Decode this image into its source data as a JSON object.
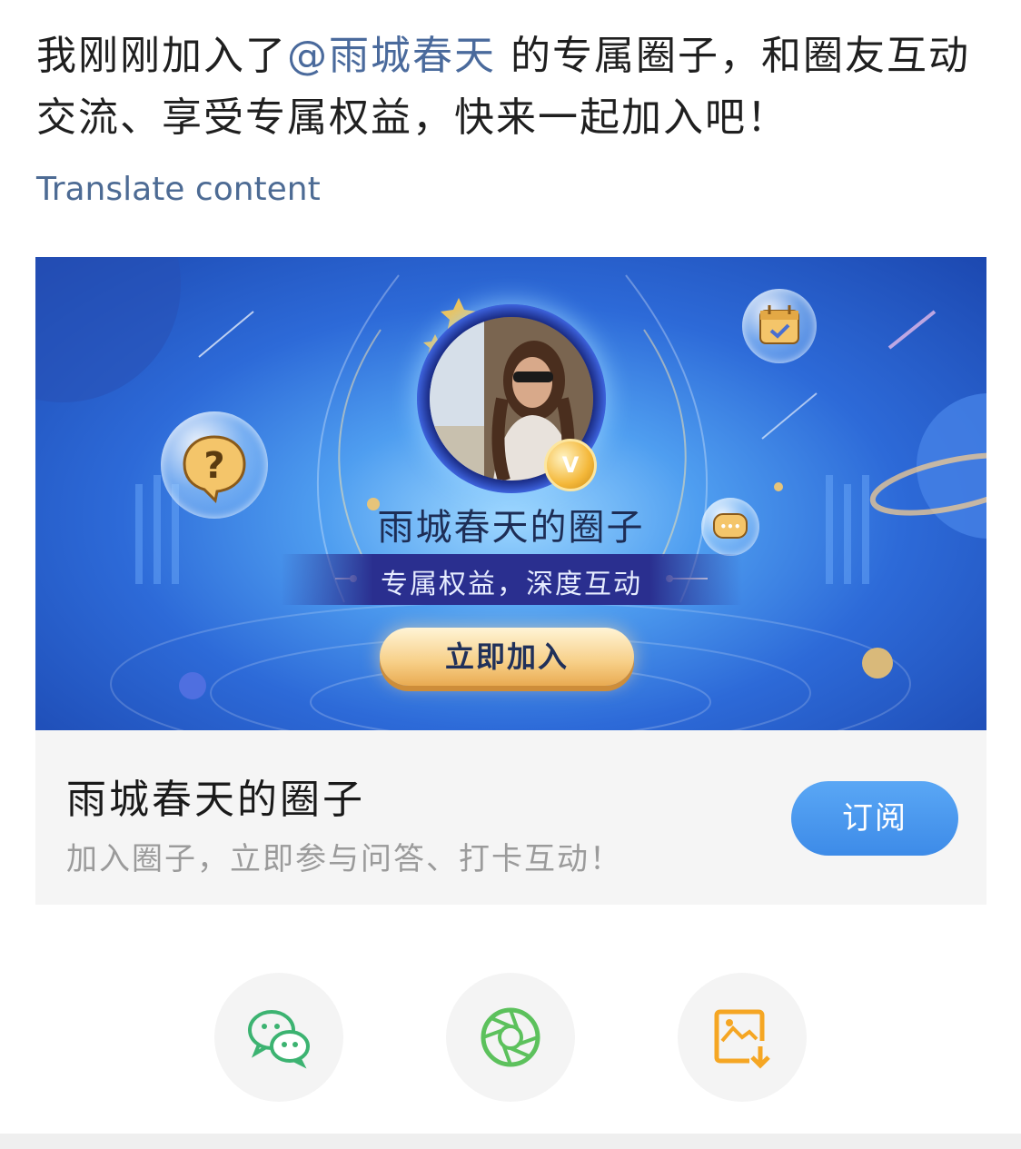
{
  "post": {
    "prefix": "我刚刚加入了",
    "mention": "@雨城春天",
    "suffix": " 的专属圈子，和圈友互动交流、享受专属权益，快来一起加入吧！",
    "translate_label": "Translate content"
  },
  "banner": {
    "title": "雨城春天的圈子",
    "ribbon": "专属权益，深度互动",
    "join_label": "立即加入",
    "badge": "V",
    "help_glyph": "?",
    "chat_glyph": "•••"
  },
  "circle_card": {
    "title": "雨城春天的圈子",
    "subtitle": "加入圈子，立即参与问答、打卡互动！",
    "subscribe_label": "订阅"
  },
  "share": {
    "items": [
      {
        "icon": "wechat-icon",
        "color": "#3cb371"
      },
      {
        "icon": "moments-icon",
        "color": "#5cc15c"
      },
      {
        "icon": "save-image-icon",
        "color": "#f5a623"
      }
    ]
  },
  "colors": {
    "mention": "#4a6a9c",
    "subscribe": "#4795ee",
    "join_button": "#f7cf87"
  }
}
